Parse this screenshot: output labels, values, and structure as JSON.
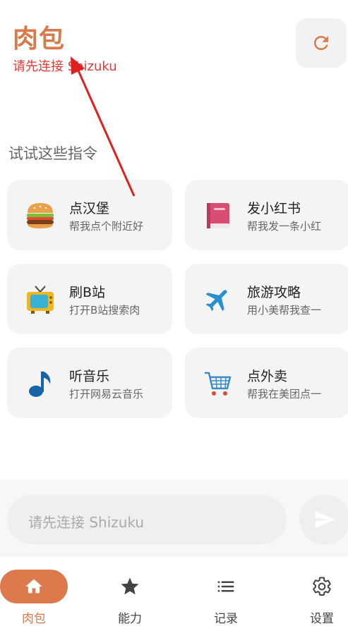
{
  "header": {
    "title": "肉包",
    "status": "请先连接 Shizuku",
    "refresh_icon": "refresh-icon"
  },
  "suggestions": {
    "section_title": "试试这些指令",
    "cards": [
      {
        "title": "点汉堡",
        "subtitle": "帮我点个附近好",
        "icon": "burger-icon"
      },
      {
        "title": "发小红书",
        "subtitle": "帮我发一条小红",
        "icon": "book-icon"
      },
      {
        "title": "刷B站",
        "subtitle": "打开B站搜索肉",
        "icon": "tv-icon"
      },
      {
        "title": "旅游攻略",
        "subtitle": "用小美帮我查一",
        "icon": "airplane-icon"
      },
      {
        "title": "听音乐",
        "subtitle": "打开网易云音乐",
        "icon": "music-note-icon"
      },
      {
        "title": "点外卖",
        "subtitle": "帮我在美团点一",
        "icon": "shopping-cart-icon"
      }
    ]
  },
  "composer": {
    "placeholder": "请先连接 Shizuku",
    "send_icon": "send-icon"
  },
  "bottom_nav": {
    "items": [
      {
        "label": "肉包",
        "icon": "home-icon",
        "active": true
      },
      {
        "label": "能力",
        "icon": "star-icon",
        "active": false
      },
      {
        "label": "记录",
        "icon": "list-icon",
        "active": false
      },
      {
        "label": "设置",
        "icon": "gear-icon",
        "active": false
      }
    ]
  },
  "colors": {
    "accent": "#dd7a4c",
    "status_red": "#e53935",
    "annotation_arrow": "#e02020"
  }
}
